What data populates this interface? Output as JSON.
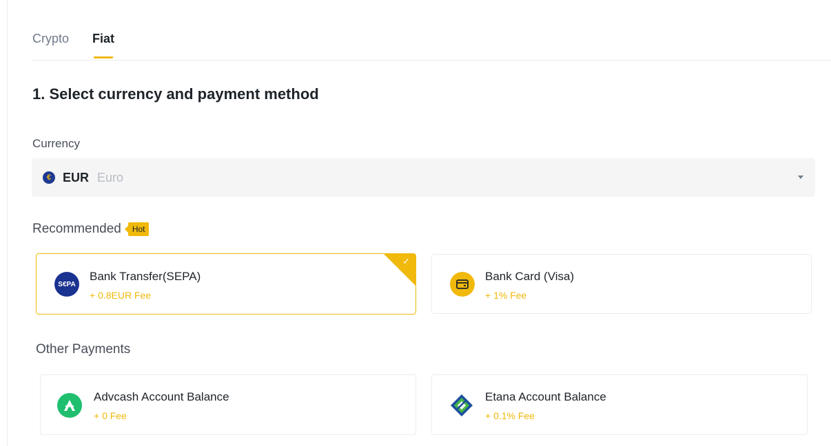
{
  "tabs": [
    {
      "label": "Crypto",
      "active": false
    },
    {
      "label": "Fiat",
      "active": true
    }
  ],
  "section": {
    "title": "1. Select currency and payment method"
  },
  "currency": {
    "label": "Currency",
    "code": "EUR",
    "name": "Euro",
    "icon": "euro-coin-icon"
  },
  "recommended": {
    "label": "Recommended",
    "badge": "Hot",
    "methods": [
      {
        "name": "Bank Transfer(SEPA)",
        "fee": "+ 0.8EUR Fee",
        "icon": "sepa-icon",
        "logo_text": "S€PA",
        "selected": true
      },
      {
        "name": "Bank Card (Visa)",
        "fee": "+ 1% Fee",
        "icon": "bank-card-icon",
        "selected": false
      }
    ]
  },
  "other": {
    "label": "Other Payments",
    "methods": [
      {
        "name": "Advcash Account Balance",
        "fee": "+ 0 Fee",
        "icon": "advcash-icon"
      },
      {
        "name": "Etana Account Balance",
        "fee": "+ 0.1% Fee",
        "icon": "etana-icon"
      }
    ]
  },
  "colors": {
    "accent": "#f0b90b",
    "text": "#1e2329",
    "muted": "#707a8a",
    "select_bg": "#f5f5f5",
    "border": "#eaecef"
  }
}
